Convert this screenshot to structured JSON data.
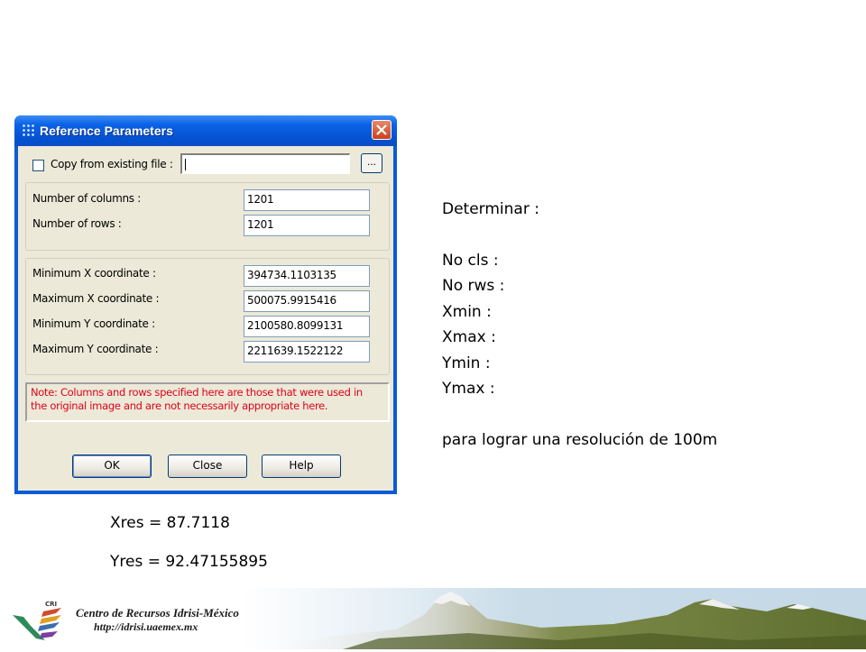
{
  "dialog": {
    "title": "Reference Parameters",
    "copy_label": "Copy from existing file :",
    "copy_value": "",
    "browse_label": "...",
    "fields": [
      {
        "label": "Number of columns :",
        "value": "1201"
      },
      {
        "label": "Number of rows :",
        "value": "1201"
      },
      {
        "label": "Minimum X coordinate :",
        "value": "394734.1103135"
      },
      {
        "label": "Maximum X coordinate :",
        "value": "500075.9915416"
      },
      {
        "label": "Minimum Y coordinate :",
        "value": "2100580.8099131"
      },
      {
        "label": "Maximum Y coordinate :",
        "value": "2211639.1522122"
      }
    ],
    "note_line1": "Note: Columns and rows specified here are those that were used in",
    "note_line2": "the original image and are not necessarily appropriate here.",
    "buttons": {
      "ok": "OK",
      "close": "Close",
      "help": "Help"
    },
    "note_color": "#e0001a"
  },
  "slide": {
    "heading": "Determinar :",
    "items": [
      "No cls :",
      "No rws :",
      "Xmin :",
      "Xmax :",
      "Ymin :",
      "Ymax :"
    ],
    "footer_line": "para lograr una resolución de 100m",
    "xres": "Xres = 87.7118",
    "yres": "Yres = 92.47155895"
  },
  "footer": {
    "logo_text": "CRI",
    "title": "Centro de Recursos Idrisi-México",
    "url": "http://idrisi.uaemex.mx"
  }
}
